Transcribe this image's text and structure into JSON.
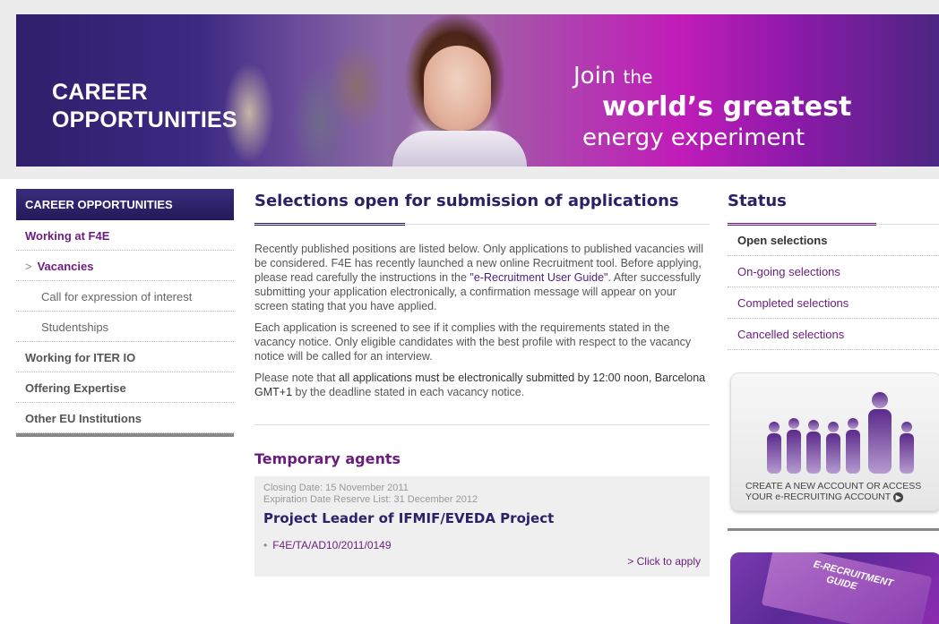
{
  "banner": {
    "title_line1": "CAREER",
    "title_line2": "OPPORTUNITIES",
    "tag_join": "Join",
    "tag_the": "the",
    "tag_line2": "world’s greatest",
    "tag_line3": "energy experiment"
  },
  "sidebar": {
    "header": "CAREER OPPORTUNITIES",
    "items": [
      {
        "label": "Working at F4E"
      },
      {
        "label": "Vacancies",
        "marker": ">"
      },
      {
        "label": "Call for expression of interest"
      },
      {
        "label": "Studentships"
      },
      {
        "label": "Working for ITER IO"
      },
      {
        "label": "Offering Expertise"
      },
      {
        "label": "Other EU Institutions"
      }
    ]
  },
  "main": {
    "title": "Selections open for submission of applications",
    "p1_a": "Recently published positions are listed below. Only applications to published vacancies will be considered. F4E has recently launched a new online Recruitment tool. Before applying, please read carefully the instructions in the ",
    "p1_link": "\"e-Recruitment User Guide\"",
    "p1_b": ". After successfully submitting your application electronically, a confirmation message will appear on your screen stating that you have applied.",
    "p2": "Each application is screened to see if it complies with the requirements stated in the vacancy notice. Only eligible candidates with the best profile with respect to the vacancy notice will be called for an interview.",
    "p3_a": "Please note that ",
    "p3_dark": "all applications must be electronically submitted by 12:00 noon, Barcelona GMT+1",
    "p3_b": " by the deadline stated in each vacancy notice.",
    "section_title": "Temporary agents",
    "vacancy": {
      "closing": "Closing Date: 15 November 2011",
      "expiration": "Expiration Date Reserve List: 31 December 2012",
      "title": "Project Leader of IFMIF/EVEDA Project",
      "reference": "F4E/TA/AD10/2011/0149",
      "apply": "> Click to apply"
    }
  },
  "status": {
    "title": "Status",
    "items": [
      {
        "label": "Open selections"
      },
      {
        "label": "On-going selections"
      },
      {
        "label": "Completed selections"
      },
      {
        "label": "Cancelled selections"
      }
    ],
    "promo_line1": "CREATE A NEW ACCOUNT OR ACCESS",
    "promo_line2": "YOUR e-RECRUITING ACCOUNT",
    "guide_line1": "E-RECRUITMENT",
    "guide_line2": "GUIDE"
  }
}
